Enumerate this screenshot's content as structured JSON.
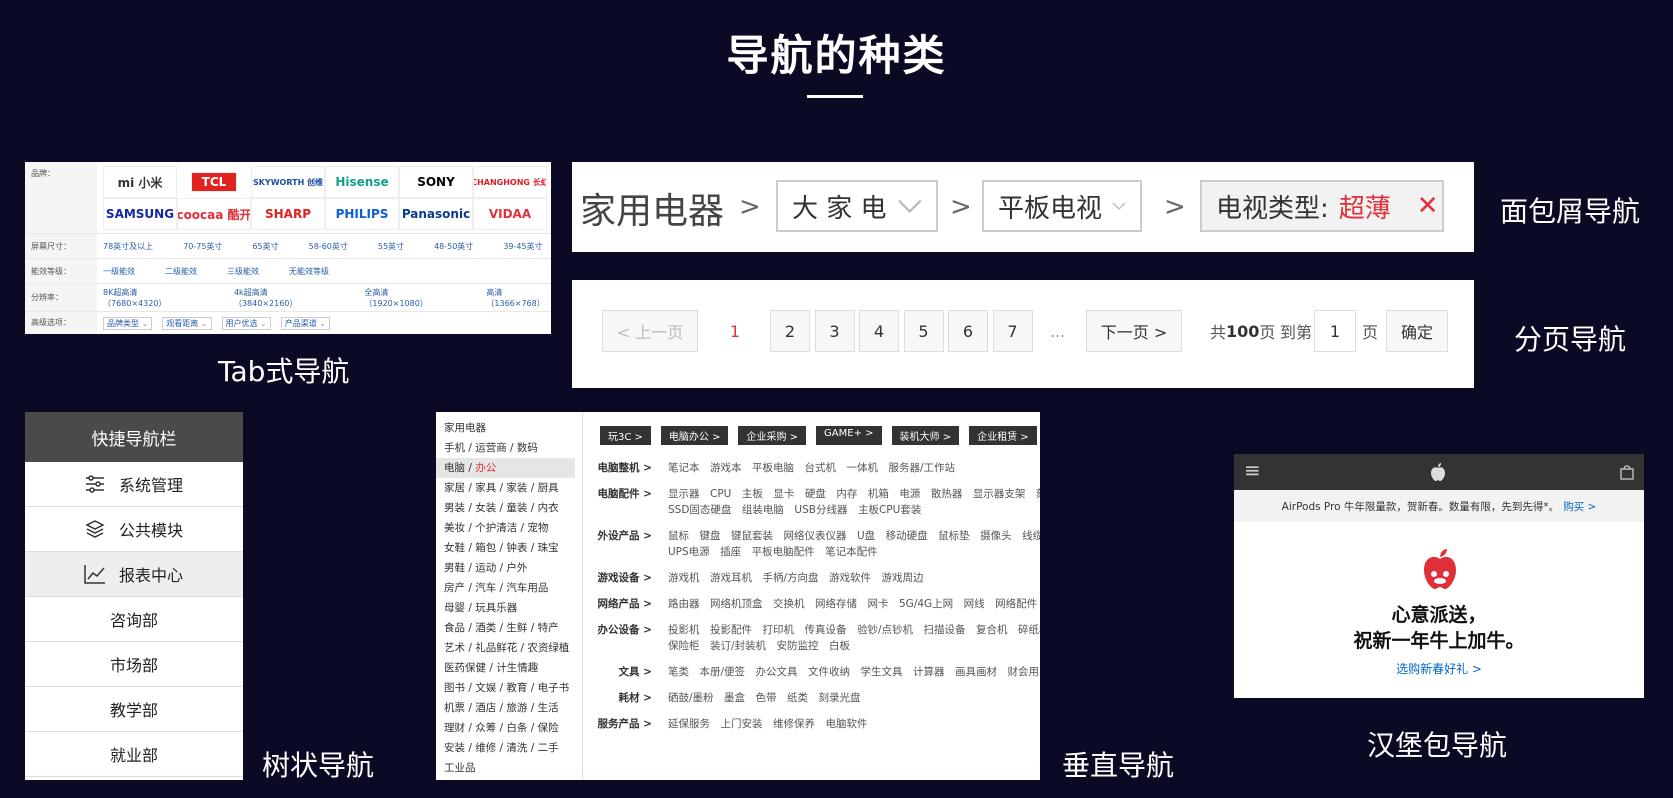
{
  "title": "导航的种类",
  "captions": {
    "tab": "Tab式导航",
    "breadcrumb": "面包屑导航",
    "pagination": "分页导航",
    "tree": "树状导航",
    "vertical": "垂直导航",
    "hamburger": "汉堡包导航"
  },
  "tab_panel": {
    "brand_label": "品牌：",
    "brands": [
      {
        "text": "mi 小米",
        "color": "#333333"
      },
      {
        "text": "TCL",
        "color": "#ffffff",
        "bg": "#e0231e"
      },
      {
        "text": "SKYWORTH 创维",
        "color": "#1a4f9c"
      },
      {
        "text": "Hisense",
        "color": "#11a08a"
      },
      {
        "text": "SONY",
        "color": "#000000"
      },
      {
        "text": "CHANGHONG 长虹",
        "color": "#d7202a"
      },
      {
        "text": "SAMSUNG",
        "color": "#1428a0"
      },
      {
        "text": "coocaa 酷开",
        "color": "#e0303a"
      },
      {
        "text": "SHARP",
        "color": "#e0231e"
      },
      {
        "text": "PHILIPS",
        "color": "#0b5ed7"
      },
      {
        "text": "Panasonic",
        "color": "#0b3c8c"
      },
      {
        "text": "VIDAA",
        "color": "#e0303a"
      }
    ],
    "rows": [
      {
        "label": "屏幕尺寸：",
        "values": [
          "78英寸及以上",
          "70-75英寸",
          "65英寸",
          "58-60英寸",
          "55英寸",
          "48-50英寸",
          "39-45英寸"
        ]
      },
      {
        "label": "能效等级：",
        "values": [
          "一级能效",
          "二级能效",
          "三级能效",
          "无能效等级"
        ]
      },
      {
        "label": "分辨率：",
        "values": [
          "8K超高清（7680×4320）",
          "4k超高清（3840×2160）",
          "全高清（1920×1080）",
          "高清（1366×768）"
        ]
      }
    ],
    "advanced_label": "高级选项：",
    "advanced_options": [
      "品牌类型",
      "观看距离",
      "用户优选",
      "产品渠道"
    ]
  },
  "breadcrumb": {
    "home": "家用电器",
    "sep": ">",
    "level1": "大 家 电",
    "level2": "平板电视",
    "filter_label": "电视类型:",
    "filter_value": "超薄",
    "close": "✕"
  },
  "pagination": {
    "prev": "< 上一页",
    "current": "1",
    "pages": [
      "2",
      "3",
      "4",
      "5",
      "6",
      "7"
    ],
    "ellipsis": "...",
    "next": "下一页 >",
    "total_prefix": "共",
    "total": "100",
    "total_suffix": "页",
    "goto_prefix": "到第",
    "goto_value": "1",
    "goto_suffix": "页",
    "confirm": "确定"
  },
  "tree": {
    "header": "快捷导航栏",
    "items": [
      "系统管理",
      "公共模块",
      "报表中心"
    ],
    "sub_items": [
      "咨询部",
      "市场部",
      "教学部",
      "就业部"
    ]
  },
  "vertical": {
    "left_items": [
      "家用电器",
      "手机 / 运营商 / 数码",
      "电脑 / 办公",
      "家居 / 家具 / 家装 / 厨具",
      "男装 / 女装 / 童装 / 内衣",
      "美妆 / 个护清洁 / 宠物",
      "女鞋 / 箱包 / 钟表 / 珠宝",
      "男鞋 / 运动 / 户外",
      "房产 / 汽车 / 汽车用品",
      "母婴 / 玩具乐器",
      "食品 / 酒类 / 生鲜 / 特产",
      "艺术 / 礼品鲜花 / 农资绿植",
      "医药保健 / 计生情趣",
      "图书 / 文娱 / 教育 / 电子书",
      "机票 / 酒店 / 旅游 / 生活",
      "理财 / 众筹 / 白条 / 保险",
      "安装 / 维修 / 清洗 / 二手",
      "工业品"
    ],
    "active_prefix": "电脑 / ",
    "active_highlight": "办公",
    "tags": [
      "玩3C >",
      "电脑办公 >",
      "企业采购 >",
      "GAME+ >",
      "装机大师 >",
      "企业租赁 >"
    ],
    "rows": [
      {
        "cat": "电脑整机 >",
        "items": "笔记本　游戏本　平板电脑　台式机　一体机　服务器/工作站"
      },
      {
        "cat": "电脑配件 >",
        "items": "显示器　CPU　主板　显卡　硬盘　内存　机箱　电源　散热器　显示器支架　刻录",
        "items2": "SSD固态硬盘　组装电脑　USB分线器　主板CPU套装"
      },
      {
        "cat": "外设产品 >",
        "items": "鼠标　键盘　键鼠套装　网络仪表仪器　U盘　移动硬盘　鼠标垫　摄像头　线缆　手",
        "items2": "UPS电源　插座　平板电脑配件　笔记本配件"
      },
      {
        "cat": "游戏设备 >",
        "items": "游戏机　游戏耳机　手柄/方向盘　游戏软件　游戏周边"
      },
      {
        "cat": "网络产品 >",
        "items": "路由器　网络机顶盒　交换机　网络存储　网卡　5G/4G上网　网线　网络配件"
      },
      {
        "cat": "办公设备 >",
        "items": "投影机　投影配件　打印机　传真设备　验钞/点钞机　扫描设备　复合机　碎纸机",
        "items2": "保险柜　装订/封装机　安防监控　白板"
      },
      {
        "cat": "文具 >",
        "items": "笔类　本册/便签　办公文具　文件收纳　学生文具　计算器　画具画材　财会用品"
      },
      {
        "cat": "耗材 >",
        "items": "硒鼓/墨粉　墨盒　色带　纸类　刻录光盘"
      },
      {
        "cat": "服务产品 >",
        "items": "延保服务　上门安装　维修保养　电脑软件"
      }
    ]
  },
  "hamburger": {
    "menu_icon": "≡",
    "promo": "AirPods Pro 牛年限量款，贺新春。数量有限，先到先得*。",
    "promo_link": "购买 >",
    "headline1": "心意派送，",
    "headline2": "祝新一年牛上加牛。",
    "link": "选购新春好礼 >",
    "colors": {
      "link": "#0066cc",
      "bar": "#333333"
    }
  }
}
